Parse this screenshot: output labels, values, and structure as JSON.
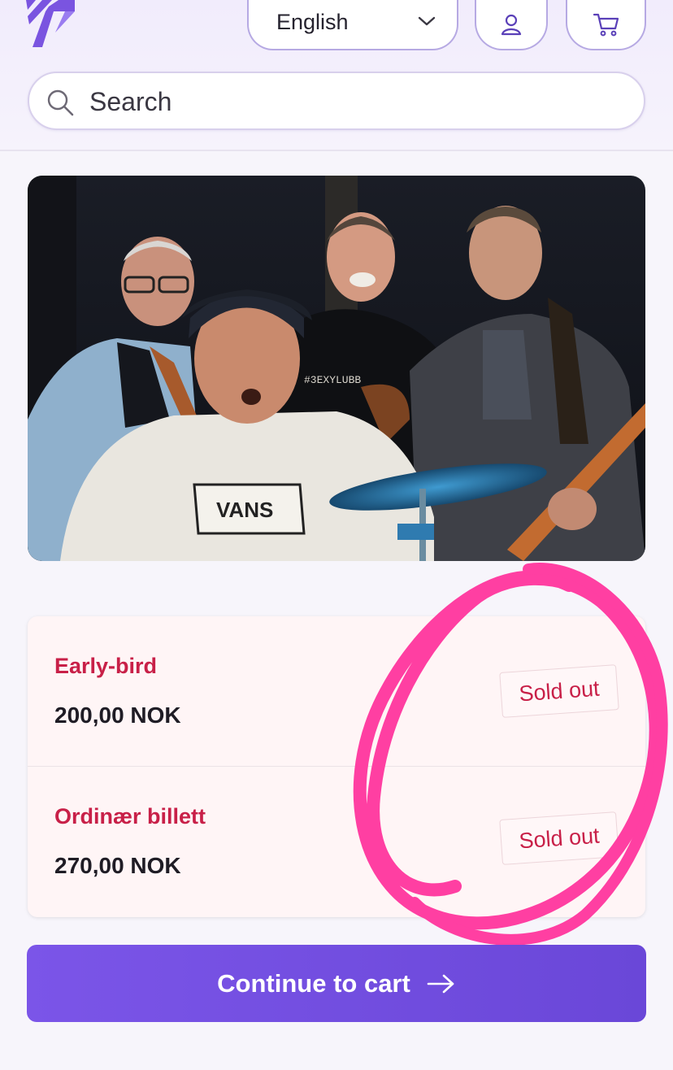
{
  "header": {
    "language": {
      "selected": "English"
    }
  },
  "search": {
    "placeholder": "Search"
  },
  "event": {
    "photo": {
      "shirt_text": "#3EXYLUBB",
      "tshirt_logo": "VANS"
    }
  },
  "tickets": [
    {
      "name": "Early-bird",
      "price": "200,00 NOK",
      "status": "Sold out"
    },
    {
      "name": "Ordinær billett",
      "price": "270,00 NOK",
      "status": "Sold out"
    }
  ],
  "cta": {
    "label": "Continue to cart"
  },
  "colors": {
    "brand_purple": "#7b55e8",
    "ticket_red": "#c82048",
    "annotation_pink": "#ff3fa2"
  },
  "icons": [
    "logo-icon",
    "chevron-down-icon",
    "user-icon",
    "cart-icon",
    "search-icon",
    "arrow-right-icon"
  ]
}
